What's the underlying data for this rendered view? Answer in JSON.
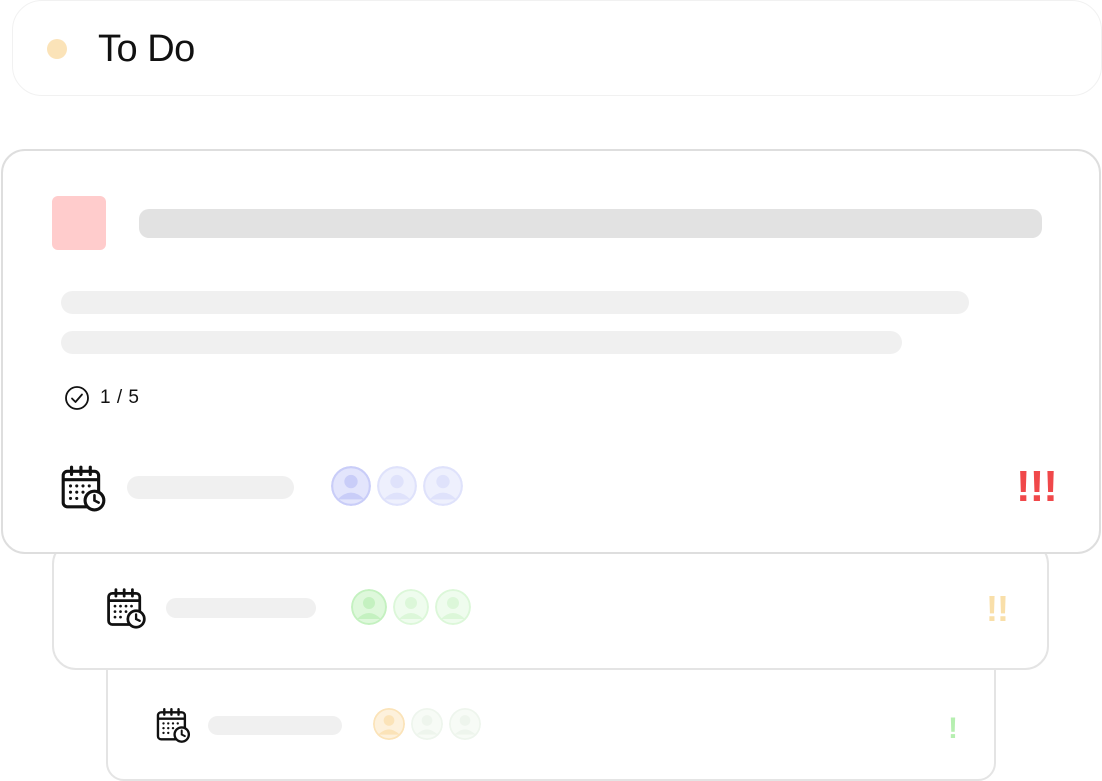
{
  "column": {
    "title": "To Do",
    "dot_color": "#fbe3b8"
  },
  "cards": [
    {
      "thumbnail_color": "#ffcccc",
      "checklist": {
        "icon": "check-circle-icon",
        "progress": "1 / 5"
      },
      "due_icon": "calendar-clock-icon",
      "assignee_color": "#c9cdf8",
      "priority": {
        "text": "!!!",
        "color": "#f0484a"
      }
    },
    {
      "due_icon": "calendar-clock-icon",
      "assignee_color": "#c4f1c0",
      "priority": {
        "text": "!!",
        "color": "#f9dfa9"
      }
    },
    {
      "due_icon": "calendar-clock-icon",
      "assignee_color": "#fbe3b8",
      "priority": {
        "text": "!",
        "color": "#b6efb0"
      }
    }
  ]
}
